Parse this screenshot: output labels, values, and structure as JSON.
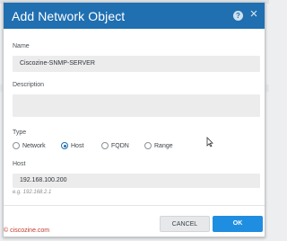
{
  "dialog": {
    "title": "Add Network Object",
    "help_icon": "question-circle-icon",
    "close_icon": "close-x-icon"
  },
  "form": {
    "name_label": "Name",
    "name_value": "Ciscozine-SNMP-SERVER",
    "description_label": "Description",
    "description_value": "",
    "type_label": "Type",
    "type_options": [
      "Network",
      "Host",
      "FQDN",
      "Range"
    ],
    "type_selected": "Host",
    "host_label": "Host",
    "host_value": "192.168.100.200",
    "host_hint": "e.g. 192.168.2.1"
  },
  "buttons": {
    "cancel": "CANCEL",
    "ok": "OK"
  },
  "watermark": {
    "text": "ciscozine.com"
  },
  "colors": {
    "titlebar": "#1f6fb1",
    "ok_button": "#1f8ee0",
    "watermark": "#c0392b"
  }
}
